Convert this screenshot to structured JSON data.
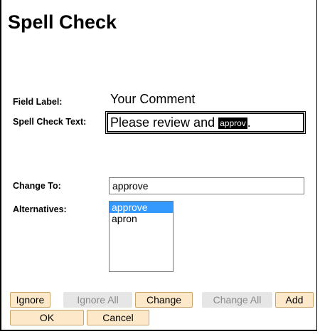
{
  "window": {
    "title": "Spell Check"
  },
  "labels": {
    "field_label": "Field Label:",
    "spell_check_text": "Spell Check Text:",
    "change_to": "Change To:",
    "alternatives": "Alternatives:"
  },
  "field_label_value": "Your Comment",
  "spell_check_text": {
    "before": "Please review and ",
    "misspelled": "approv",
    "after": "."
  },
  "change_to_value": "approve",
  "alternatives": {
    "options": [
      "approve",
      "apron"
    ],
    "selected": "approve"
  },
  "buttons": {
    "ignore": "Ignore",
    "ignore_all": "Ignore All",
    "change": "Change",
    "change_all": "Change All",
    "add": "Add",
    "ok": "OK",
    "cancel": "Cancel"
  },
  "colors": {
    "button_bg": "#fde9c9",
    "button_border": "#c9a46c",
    "disabled_bg": "#e6e6e6",
    "selection": "#3399ff"
  }
}
